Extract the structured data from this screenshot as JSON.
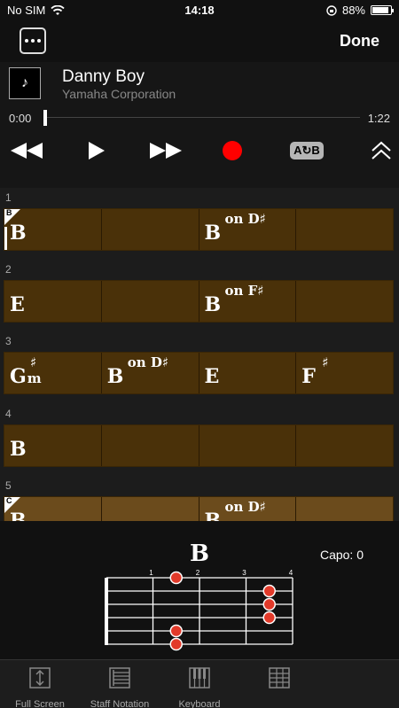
{
  "status": {
    "carrier": "No SIM",
    "time": "14:18",
    "battery": "88%",
    "battery_level": 0.88
  },
  "topbar": {
    "done_label": "Done"
  },
  "player": {
    "title": "Danny Boy",
    "artist": "Yamaha Corporation",
    "time_current": "0:00",
    "time_total": "1:22",
    "progress": 0.0,
    "ab_label": "A↻B",
    "album_icon": "music-note-icon"
  },
  "chart_rows": [
    {
      "number": "1",
      "section": "B",
      "bars": [
        {
          "root": "B"
        },
        {
          "root": ""
        },
        {
          "root": "B",
          "sup": "on D♯"
        },
        {
          "root": ""
        }
      ]
    },
    {
      "number": "2",
      "section": "",
      "bars": [
        {
          "root": "E"
        },
        {
          "root": ""
        },
        {
          "root": "B",
          "sup": "on F♯"
        },
        {
          "root": ""
        }
      ]
    },
    {
      "number": "3",
      "section": "",
      "bars": [
        {
          "root": "G",
          "sup": "♯",
          "sub": "m"
        },
        {
          "root": "B",
          "sup": "on D♯"
        },
        {
          "root": "E"
        },
        {
          "root": "F",
          "sup": "♯"
        }
      ]
    },
    {
      "number": "4",
      "section": "",
      "bars": [
        {
          "root": "B"
        },
        {
          "root": ""
        },
        {
          "root": ""
        },
        {
          "root": ""
        }
      ]
    },
    {
      "number": "5",
      "section": "C",
      "bars": [
        {
          "root": "B"
        },
        {
          "root": ""
        },
        {
          "root": "B",
          "sup": "on D♯"
        },
        {
          "root": ""
        }
      ]
    }
  ],
  "diagram": {
    "chord": "B",
    "capo": "Capo: 0",
    "fret_labels": [
      "1",
      "2",
      "3",
      "4"
    ],
    "dots": [
      {
        "string": 1,
        "fret": 2
      },
      {
        "string": 2,
        "fret": 4
      },
      {
        "string": 3,
        "fret": 4
      },
      {
        "string": 4,
        "fret": 4
      },
      {
        "string": 5,
        "fret": 2
      },
      {
        "string": 6,
        "fret": 2
      }
    ]
  },
  "tabs": [
    {
      "label": "Full Screen",
      "icon": "full-screen-icon"
    },
    {
      "label": "Staff Notation",
      "icon": "staff-notation-icon"
    },
    {
      "label": "Keyboard",
      "icon": "keyboard-icon"
    },
    {
      "label": "",
      "icon": "guitar-icon"
    }
  ]
}
